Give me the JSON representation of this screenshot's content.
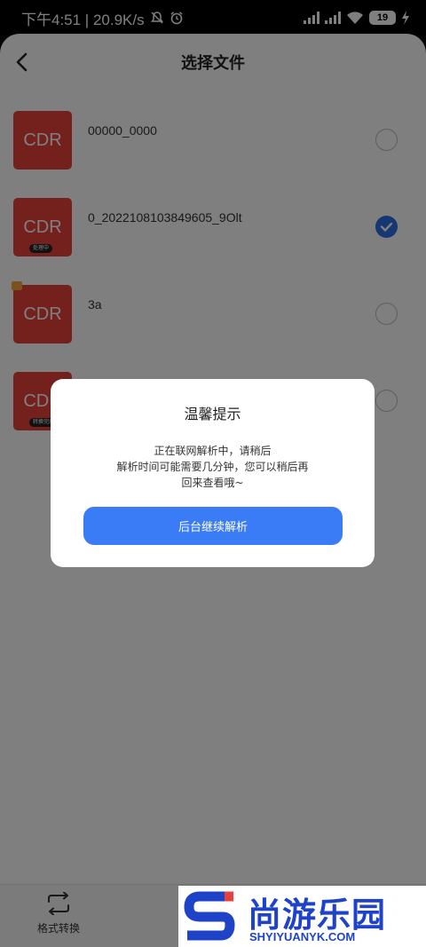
{
  "status_bar": {
    "time_speed": "下午4:51 | 20.9K/s",
    "battery": "19"
  },
  "header": {
    "title": "选择文件"
  },
  "files": [
    {
      "thumb_label": "CDR",
      "name": "00000_0000",
      "checked": false,
      "chip": ""
    },
    {
      "thumb_label": "CDR",
      "name": "0_2022108103849605_9Olt",
      "checked": true,
      "chip": "处理中"
    },
    {
      "thumb_label": "CDR",
      "name": "3a",
      "checked": false,
      "chip": ""
    },
    {
      "thumb_label": "CDR",
      "name": "",
      "checked": false,
      "chip": "转换完成"
    }
  ],
  "bottom_bar": {
    "convert_label": "格式转换"
  },
  "dialog": {
    "title": "温馨提示",
    "message_line1": "正在联网解析中，请稍后",
    "message_line2": "解析时间可能需要几分钟，您可以稍后再",
    "message_line3": "回来查看哦~",
    "button_label": "后台继续解析"
  },
  "watermark": {
    "logo_text": "尚游乐园",
    "url": "SHYIYUANYK.COM"
  },
  "colors": {
    "accent": "#3a7bf6",
    "checked_radio": "#2f6fe4",
    "thumb_red": "#e8413b",
    "watermark_blue": "#1e43c8"
  }
}
